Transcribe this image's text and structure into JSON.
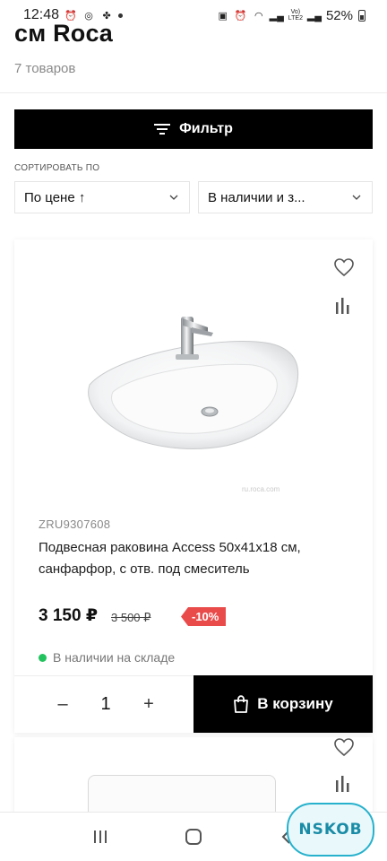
{
  "status_bar": {
    "time": "12:48",
    "battery": "52%"
  },
  "header": {
    "title": "см Roca",
    "count": "7 товаров"
  },
  "filter": {
    "label": "Фильтр"
  },
  "sort": {
    "label": "СОРТИРОВАТЬ ПО",
    "price_select": "По цене ↑",
    "stock_select": "В наличии и з..."
  },
  "product": {
    "sku": "ZRU9307608",
    "name": "Подвесная раковина Access 50x41x18 см, санфарфор, с отв. под смеситель",
    "price": "3 150 ₽",
    "old_price": "3 500 ₽",
    "discount": "-10%",
    "stock": "В наличии на складе",
    "watermark": "ru.roca.com",
    "quantity": "1",
    "minus": "–",
    "plus": "+",
    "cart_label": "В корзину"
  },
  "colors": {
    "accent": "#000000",
    "discount": "#e94b4b",
    "in_stock": "#22c35e"
  },
  "icons": {
    "favorite": "heart-icon",
    "compare": "bar-chart-icon",
    "filter": "filter-lines-icon",
    "cart": "shopping-bag-icon"
  },
  "overlay": {
    "logo_text": "NSKOB"
  }
}
